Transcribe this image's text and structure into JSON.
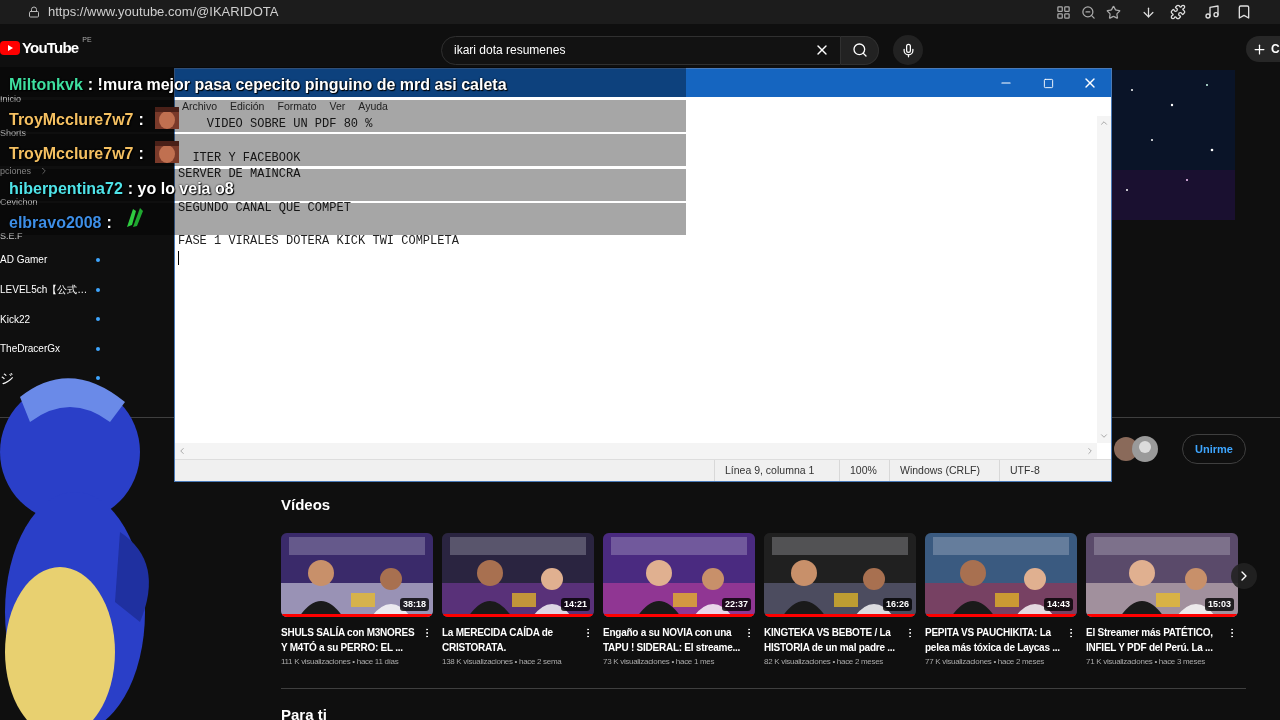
{
  "browser": {
    "url": "https://www.youtube.com/@IKARIDOTA"
  },
  "header": {
    "logo_text": "YouTube",
    "country": "PE",
    "search": {
      "value": "ikari dota resumenes"
    },
    "create_label": "C"
  },
  "sidebar": {
    "items": [
      {
        "label": "Inicio",
        "kind": "nav"
      },
      {
        "label": "Shorts",
        "kind": "nav"
      },
      {
        "label": "pciones",
        "kind": "section"
      },
      {
        "label": "Cevichon",
        "kind": "nav"
      },
      {
        "label": "S.E.F",
        "kind": "nav"
      },
      {
        "label": "AD Gamer",
        "kind": "channel",
        "new_content": true
      },
      {
        "label": "LEVEL5ch【公式…",
        "kind": "channel",
        "new_content": true
      },
      {
        "label": "Kick22",
        "kind": "channel",
        "new_content": true
      },
      {
        "label": "TheDracerGx",
        "kind": "channel",
        "new_content": true
      },
      {
        "label": "ジ",
        "kind": "partial",
        "new_content": true
      }
    ]
  },
  "channel": {
    "join_label": "Unirme"
  },
  "videos_section": {
    "title": "Vídeos",
    "videos": [
      {
        "title_lines": [
          "SHULS SALÍA con M3NORES",
          "Y M4TÓ a su PERRO: EL ..."
        ],
        "meta": "111 K visualizaciones • hace 11 días",
        "duration": "38:18",
        "level": 1
      },
      {
        "title_lines": [
          "La MERECIDA CAÍDA de",
          "CRISTORATA."
        ],
        "meta": "138 K visualizaciones • hace 2 sema",
        "duration": "14:21",
        "level": 1
      },
      {
        "title_lines": [
          "Engaño a su NOVIA con una",
          "TAPU ! SIDERAL: El streame..."
        ],
        "meta": "73 K visualizaciones • hace 1 mes",
        "duration": "22:37",
        "level": 1
      },
      {
        "title_lines": [
          "KINGTEKA VS BEBOTE / La",
          "HISTORIA de un mal padre ..."
        ],
        "meta": "82 K visualizaciones • hace 2 meses",
        "duration": "16:26",
        "level": 1
      },
      {
        "title_lines": [
          "PEPITA VS PAUCHIKITA: La",
          "pelea más tóxica de Laycas ..."
        ],
        "meta": "77 K visualizaciones • hace 2 meses",
        "duration": "14:43",
        "level": 1
      },
      {
        "title_lines": [
          "El Streamer más PATÉTICO,",
          "INFIEL Y PDF del Perú. La ..."
        ],
        "meta": "71 K visualizaciones • hace 3 meses",
        "duration": "15:03",
        "level": 1
      }
    ]
  },
  "next_section": {
    "title": "Para ti"
  },
  "notepad": {
    "menu": [
      "Archivo",
      "Edición",
      "Formato",
      "Ver",
      "Ayuda"
    ],
    "paragraphs": [
      [
        "    VIDEO SOBRE UN PDF 80 %"
      ],
      [
        "  ITER Y FACEBOOK",
        "SERVER DE MAINCRA"
      ],
      [
        "SEGUNDO CANAL QUE COMPET"
      ],
      [
        "FASE 1 VIRALES DOTERA KICK TWI COMPLETA"
      ]
    ],
    "status": [
      "Línea 9, columna 1",
      "100%",
      "Windows (CRLF)",
      "UTF-8"
    ]
  },
  "chat": [
    {
      "user": "Miltonkvk",
      "color": "#3ee0a0",
      "message": ": !mura mejor pasa cepecito pinguino de mrd asi caleta",
      "kind": "text"
    },
    {
      "user": "TroyMcclure7w7",
      "color": "#f5c061",
      "message": ":",
      "kind": "face"
    },
    {
      "user": "TroyMcclure7w7",
      "color": "#f5c061",
      "message": ":",
      "kind": "face"
    },
    {
      "user": "hiberpentina72",
      "color": "#4fe3e8",
      "message": ": yo lo veia o8",
      "kind": "text"
    },
    {
      "user": "elbravo2008",
      "color": "#3d8ee6",
      "message": ":",
      "kind": "hands"
    }
  ]
}
